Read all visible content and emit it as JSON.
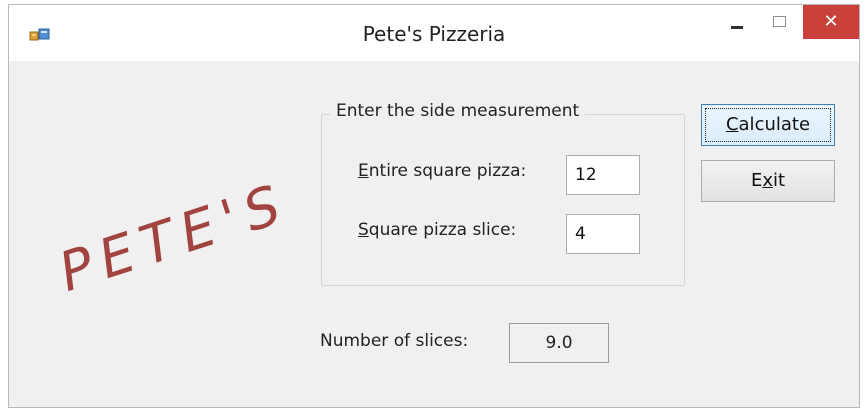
{
  "window": {
    "title": "Pete's Pizzeria",
    "close_glyph": "✕"
  },
  "logo": {
    "text": "PETE'S",
    "color": "#a1433f"
  },
  "group": {
    "label": "Enter the side measurement",
    "entire": {
      "accel": "E",
      "rest": "ntire square pizza:",
      "value": "12"
    },
    "slice": {
      "accel": "S",
      "rest": "quare pizza slice:",
      "value": "4"
    }
  },
  "buttons": {
    "calculate": {
      "accel": "C",
      "rest": "alculate"
    },
    "exit": {
      "pre": "E",
      "accel": "x",
      "rest": "it"
    }
  },
  "result": {
    "label": "Number of slices:",
    "value": "9.0"
  },
  "colors": {
    "close_button": "#c9403a",
    "focus_border": "#3c7fb1"
  }
}
